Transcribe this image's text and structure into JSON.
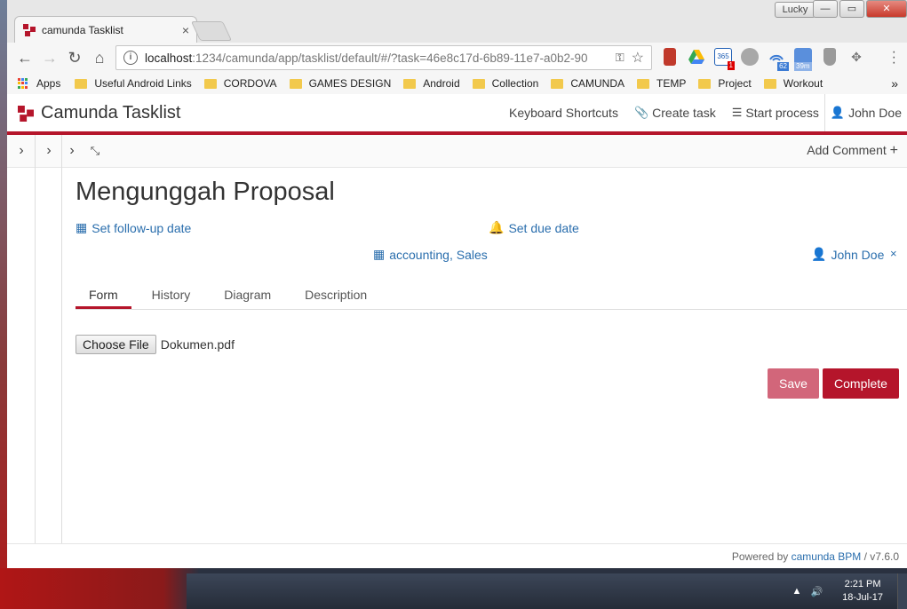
{
  "browser": {
    "tab_title": "camunda Tasklist",
    "tab_close": "×",
    "profile_name": "Lucky",
    "win_min": "—",
    "win_max": "▭",
    "win_close": "✕",
    "url_host": "localhost",
    "url_path": ":1234/camunda/app/tasklist/default/#/?task=46e8c17d-6b89-11e7-a0b2-90",
    "back_icon": "←",
    "forward_icon": "→",
    "reload_icon": "↻",
    "home_icon": "⌂",
    "star_icon": "☆",
    "key_icon": "⚿",
    "extensions": [
      {
        "name": "pdf-extension",
        "color": "#c0392b"
      },
      {
        "name": "google-drive",
        "color": "#34a853"
      },
      {
        "name": "office-365",
        "color": "#1f5fb5"
      },
      {
        "name": "gray-extension",
        "color": "#9a9a9a"
      },
      {
        "name": "wifi-extension",
        "color": "#3b7bd4"
      },
      {
        "name": "timer-extension",
        "color": "#5a8fdc"
      },
      {
        "name": "shield-extension",
        "color": "#8d8d8d"
      },
      {
        "name": "move-extension",
        "color": "#777777"
      }
    ],
    "ext_badges": {
      "office": "1",
      "wifi": "62",
      "timer": "39m"
    },
    "bookmarks_apps": "Apps",
    "bookmarks": [
      "Useful Android Links",
      "CORDOVA",
      "GAMES DESIGN",
      "Android",
      "Collection",
      "CAMUNDA",
      "TEMP",
      "Project",
      "Workout"
    ],
    "bookmarks_more": "»"
  },
  "header": {
    "brand": "Camunda Tasklist",
    "keyboard_shortcuts": "Keyboard Shortcuts",
    "create_task": "Create task",
    "start_process": "Start process",
    "user": "John Doe"
  },
  "subbar": {
    "expand1": "›",
    "expand2": "›",
    "expand3": "›",
    "add_comment": "Add Comment",
    "add_icon": "+"
  },
  "task": {
    "title": "Mengunggah Proposal",
    "follow_up": "Set follow-up date",
    "due_date": "Set due date",
    "groups": "accounting, Sales",
    "assignee": "John Doe",
    "remove_assignee": "×",
    "tabs": [
      "Form",
      "History",
      "Diagram",
      "Description"
    ],
    "active_tab": "Form",
    "choose_file": "Choose File",
    "file_name": "Dokumen.pdf",
    "save": "Save",
    "complete": "Complete"
  },
  "footer": {
    "powered_by": "Powered by",
    "product": "camunda BPM",
    "version": "/ v7.6.0"
  },
  "taskbar": {
    "time": "2:21 PM",
    "date": "18-Jul-17",
    "tray_up": "▲",
    "volume_icon": "🔊"
  },
  "colors": {
    "brand_red": "#b5152b",
    "save_pink": "#d2667a",
    "link_blue": "#2a6ead"
  }
}
